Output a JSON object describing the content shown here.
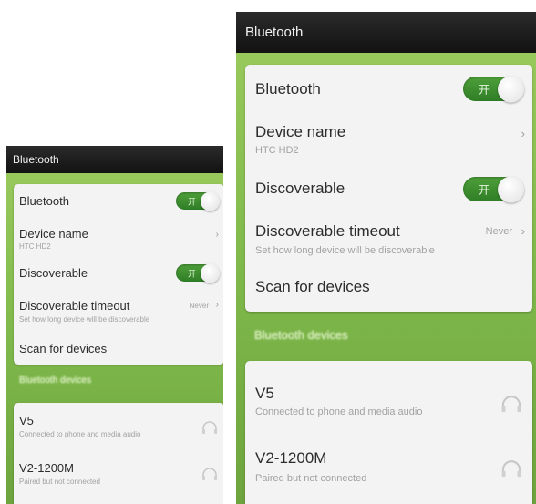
{
  "screens": [
    {
      "header": {
        "title": "Bluetooth"
      },
      "settings": {
        "bluetooth": {
          "label": "Bluetooth",
          "toggle_text": "开",
          "state": "on"
        },
        "device_name": {
          "label": "Device name",
          "value": "HTC HD2"
        },
        "discoverable": {
          "label": "Discoverable",
          "toggle_text": "开",
          "state": "on"
        },
        "discoverable_timeout": {
          "label": "Discoverable timeout",
          "summary": "Set how long device will be discoverable",
          "value": "Never"
        },
        "scan": {
          "label": "Scan for devices"
        }
      },
      "section_header": "Bluetooth devices",
      "devices": [
        {
          "name": "V5",
          "status": "Connected to phone and media audio",
          "icon": "headset-icon"
        },
        {
          "name": "V2-1200M",
          "status": "Paired but not connected",
          "icon": "headset-icon"
        }
      ]
    },
    {
      "header": {
        "title": "Bluetooth"
      },
      "settings": {
        "bluetooth": {
          "label": "Bluetooth",
          "toggle_text": "开",
          "state": "on"
        },
        "device_name": {
          "label": "Device name",
          "value": "HTC HD2"
        },
        "discoverable": {
          "label": "Discoverable",
          "toggle_text": "开",
          "state": "on"
        },
        "discoverable_timeout": {
          "label": "Discoverable timeout",
          "summary": "Set how long device will be discoverable",
          "value": "Never"
        },
        "scan": {
          "label": "Scan for devices"
        }
      },
      "section_header": "Bluetooth devices",
      "devices": [
        {
          "name": "V5",
          "status": "Connected to phone and media audio",
          "icon": "headset-icon"
        },
        {
          "name": "V2-1200M",
          "status": "Paired but not connected",
          "icon": "headset-icon"
        }
      ]
    }
  ],
  "colors": {
    "accent_green": "#3a8f2e",
    "background_green": "#8cc152",
    "title_bar": "#1a1a1a",
    "card": "#f3f3f3"
  }
}
